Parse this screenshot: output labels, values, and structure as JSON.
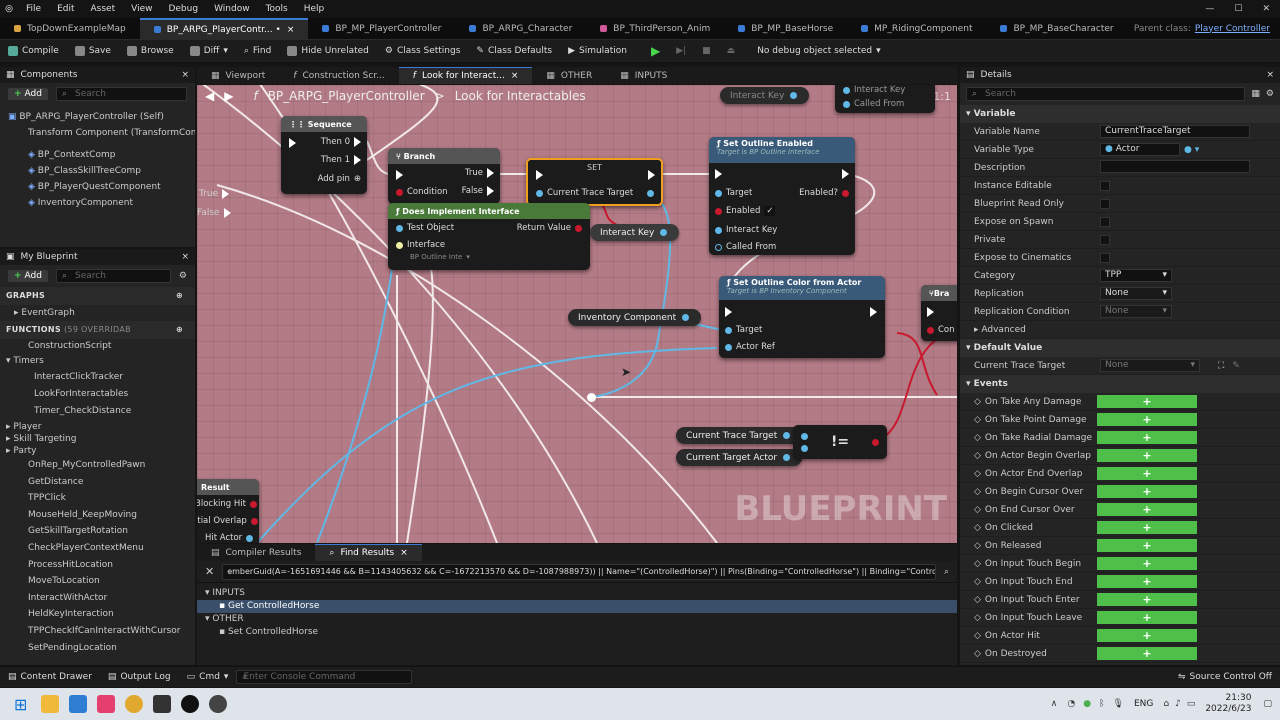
{
  "menu": [
    "File",
    "Edit",
    "Asset",
    "View",
    "Debug",
    "Window",
    "Tools",
    "Help"
  ],
  "window_controls": [
    "—",
    "☐",
    "✕"
  ],
  "tabs": [
    "TopDownExampleMap",
    "BP_ARPG_PlayerContr... •",
    "BP_MP_PlayerController",
    "BP_ARPG_Character",
    "BP_ThirdPerson_Anim",
    "BP_MP_BaseHorse",
    "MP_RidingComponent",
    "BP_MP_BaseCharacter"
  ],
  "parent_class_label": "Parent class:",
  "parent_class_value": "Player Controller",
  "toolbar": {
    "compile": "Compile",
    "save": "Save",
    "browse": "Browse",
    "diff": "Diff",
    "find": "Find",
    "hide_unrelated": "Hide Unrelated",
    "class_settings": "Class Settings",
    "class_defaults": "Class Defaults",
    "simulation": "Simulation",
    "debug_object": "No debug object selected"
  },
  "components": {
    "title": "Components",
    "add": "Add",
    "search_placeholder": "Search",
    "items": [
      "BP_ARPG_PlayerController (Self)",
      "Transform Component (TransformComp",
      "BP_ContextComp",
      "BP_ClassSkillTreeComp",
      "BP_PlayerQuestComponent",
      "InventoryComponent"
    ]
  },
  "my_blueprint": {
    "title": "My Blueprint",
    "add": "Add",
    "search_placeholder": "Search",
    "graphs_label": "GRAPHS",
    "event_graph": "EventGraph",
    "functions_label": "FUNCTIONS",
    "functions_overridable": "(59 OVERRIDAB",
    "items": [
      "ConstructionScript",
      "Timers",
      "InteractClickTracker",
      "LookForInteractables",
      "Timer_CheckDistance",
      "Player",
      "Skill Targeting",
      "Party",
      "OnRep_MyControlledPawn",
      "GetDistance",
      "TPPClick",
      "MouseHeld_KeepMoving",
      "GetSkillTargetRotation",
      "CheckPlayerContextMenu",
      "ProcessHitLocation",
      "MoveToLocation",
      "InteractWithActor",
      "HeldKeyInteraction",
      "TPPCheckIfCanInteractWithCursor",
      "SetPendingLocation"
    ]
  },
  "editor_tabs": [
    "Viewport",
    "Construction Scr...",
    "Look for Interact...",
    "OTHER",
    "INPUTS"
  ],
  "breadcrumb": {
    "class": "BP_ARPG_PlayerController",
    "separator": ">",
    "function": "Look for Interactables"
  },
  "zoom": "Zoom 1:1",
  "watermark": "BLUEPRINT",
  "nodes": {
    "sequence": {
      "title": "Sequence",
      "then0": "Then 0",
      "then1": "Then 1",
      "add_pin": "Add pin"
    },
    "branch": {
      "title": "Branch",
      "condition": "Condition",
      "true": "True",
      "false": "False"
    },
    "set": {
      "title": "SET",
      "pin": "Current Trace Target"
    },
    "does_implement": {
      "title": "Does Implement Interface",
      "test_object": "Test Object",
      "return_value": "Return Value",
      "interface": "Interface",
      "interface_value": "BP Outline Inte"
    },
    "set_outline": {
      "title": "Set Outline Enabled",
      "subtitle": "Target is BP Outline Interface",
      "target": "Target",
      "enabled_q": "Enabled?",
      "enabled": "Enabled",
      "interact_key": "Interact Key",
      "called_from": "Called From"
    },
    "set_outline_color": {
      "title": "Set Outline Color from Actor",
      "subtitle": "Target is BP Inventory Component",
      "target": "Target",
      "actor_ref": "Actor Ref"
    },
    "not_equal": {
      "symbol": "!="
    },
    "result_node": {
      "title": "Result",
      "blocking_hit": "Blocking Hit",
      "initial_overlap": "itial Overlap",
      "hit_actor": "Hit Actor"
    },
    "left_pins": {
      "true": "True",
      "false": "False"
    },
    "partial_top": {
      "interact_key": "Interact Key",
      "called_from": "Called From"
    },
    "partial_right": {
      "title": "Bra",
      "con": "Con"
    }
  },
  "variables": {
    "interact_key": "Interact Key",
    "inventory_component": "Inventory Component",
    "current_trace_target": "Current Trace Target",
    "current_target_actor": "Current Target Actor",
    "interact_key_top": "Interact Key"
  },
  "bottom": {
    "tabs": [
      "Compiler Results",
      "Find Results"
    ],
    "query": "emberGuid(A=-1651691446 && B=1143405632 && C=-1672213570 && D=-1087988973)) || Name=\"(ControlledHorse)\") || Pins(Binding=\"ControlledHorse\") || Binding=\"ControlledHorse",
    "inputs_label": "INPUTS",
    "inputs_item": "Get ControlledHorse",
    "other_label": "OTHER",
    "other_item": "Set ControlledHorse"
  },
  "details": {
    "title": "Details",
    "search_placeholder": "Search",
    "variable_section": "Variable",
    "rows": [
      {
        "label": "Variable Name",
        "value": "CurrentTraceTarget"
      },
      {
        "label": "Variable Type",
        "value": "Actor"
      },
      {
        "label": "Description",
        "value": ""
      },
      {
        "label": "Instance Editable",
        "value": ""
      },
      {
        "label": "Blueprint Read Only",
        "value": ""
      },
      {
        "label": "Expose on Spawn",
        "value": ""
      },
      {
        "label": "Private",
        "value": ""
      },
      {
        "label": "Expose to Cinematics",
        "value": ""
      },
      {
        "label": "Category",
        "value": "TPP"
      },
      {
        "label": "Replication",
        "value": "None"
      },
      {
        "label": "Replication Condition",
        "value": "None"
      },
      {
        "label": "Advanced",
        "value": ""
      }
    ],
    "default_section": "Default Value",
    "default_row": {
      "label": "Current Trace Target",
      "value": "None"
    },
    "events_section": "Events",
    "events": [
      "On Take Any Damage",
      "On Take Point Damage",
      "On Take Radial Damage",
      "On Actor Begin Overlap",
      "On Actor End Overlap",
      "On Begin Cursor Over",
      "On End Cursor Over",
      "On Clicked",
      "On Released",
      "On Input Touch Begin",
      "On Input Touch End",
      "On Input Touch Enter",
      "On Input Touch Leave",
      "On Actor Hit",
      "On Destroyed"
    ],
    "plus": "+"
  },
  "status": {
    "content_drawer": "Content Drawer",
    "output_log": "Output Log",
    "cmd": "Cmd",
    "console_placeholder": "Enter Console Command",
    "source_control": "Source Control Off"
  },
  "taskbar": {
    "lang": "ENG",
    "time": "21:30",
    "date": "2022/6/23"
  },
  "colors": {
    "graph_bg": "#b37b86",
    "green": "#4ec04a",
    "accent": "#3a7bd5"
  }
}
